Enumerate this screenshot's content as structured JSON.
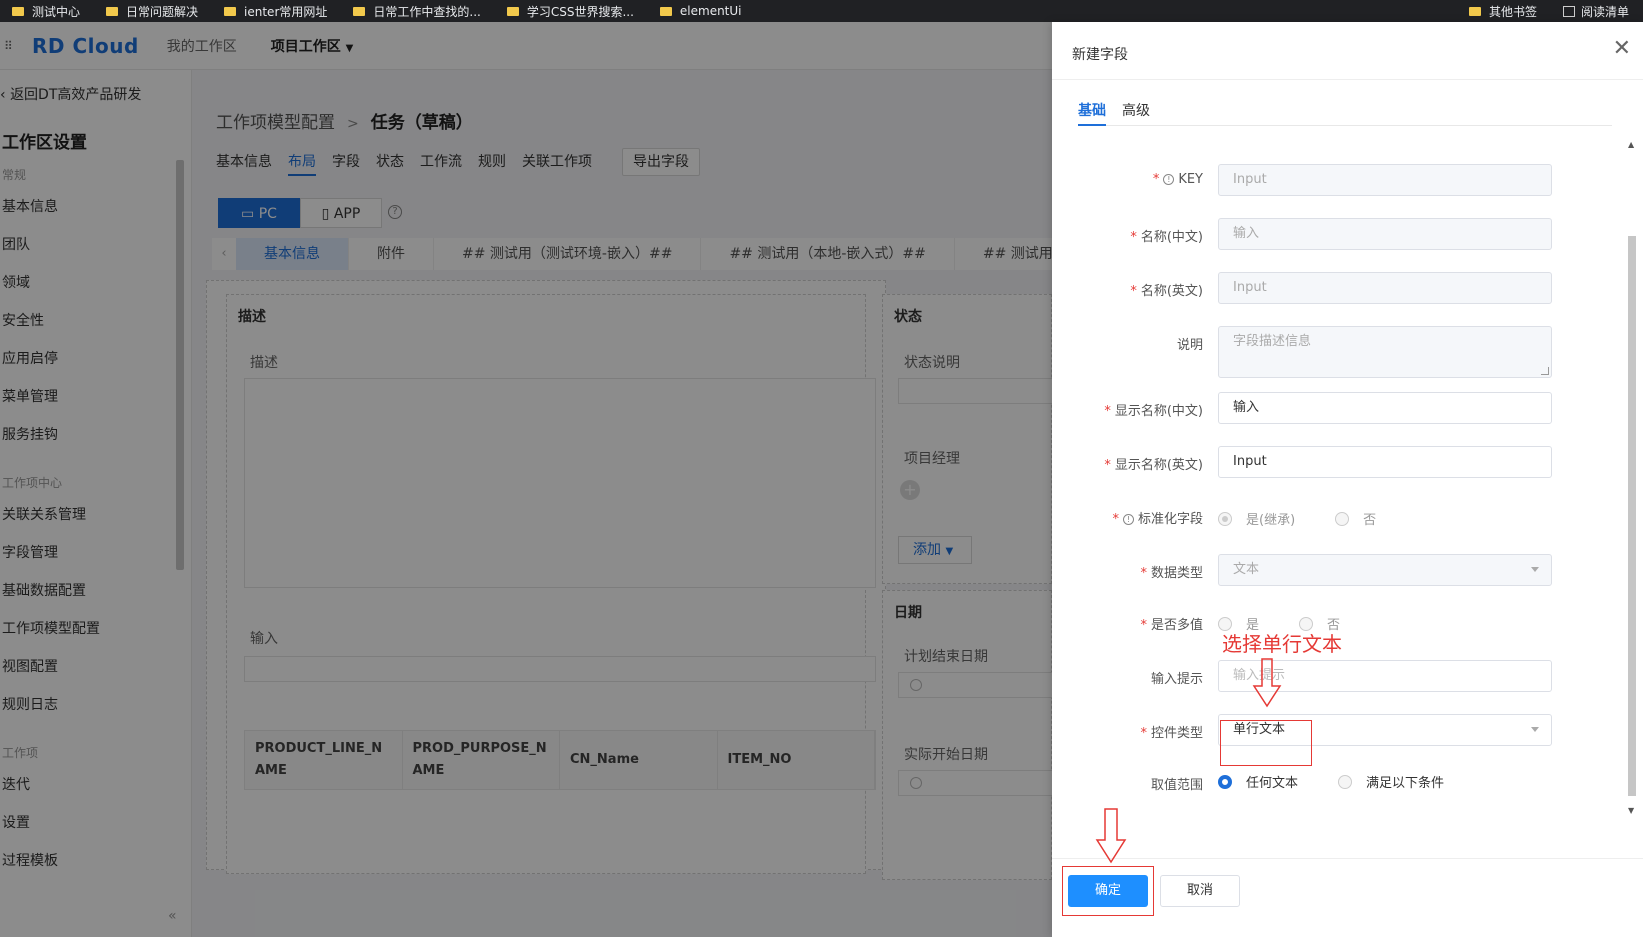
{
  "bookmarks": [
    {
      "label": "测试中心"
    },
    {
      "label": "日常问题解决"
    },
    {
      "label": "ienter常用网址"
    },
    {
      "label": "日常工作中查找的..."
    },
    {
      "label": "学习CSS世界搜索..."
    },
    {
      "label": "elementUi"
    }
  ],
  "bookmarks_right": {
    "other": "其他书签",
    "reading": "阅读清单"
  },
  "topbar": {
    "logo": "RD Cloud",
    "nav_my": "我的工作区",
    "nav_project": "项目工作区"
  },
  "sidebar": {
    "back": "返回DT高效产品研发",
    "title": "工作区设置",
    "group_general": "常规",
    "general_items": [
      "基本信息",
      "团队",
      "领域",
      "安全性",
      "应用启停",
      "菜单管理",
      "服务挂钩"
    ],
    "group_workitem": "工作项中心",
    "workitem_items": [
      "关联关系管理",
      "字段管理",
      "基础数据配置",
      "工作项模型配置",
      "视图配置",
      "规则日志"
    ],
    "group_work": "工作项",
    "work_items": [
      "迭代",
      "设置",
      "过程模板"
    ]
  },
  "main": {
    "crumb_parent": "工作项模型配置",
    "crumb_sep": ">",
    "crumb_current": "任务（草稿）",
    "tabs": [
      "基本信息",
      "布局",
      "字段",
      "状态",
      "工作流",
      "规则",
      "关联工作项"
    ],
    "export_btn": "导出字段",
    "seg_pc": "PC",
    "seg_app": "APP",
    "sections": [
      "基本信息",
      "附件",
      "## 测试用（测试环境-嵌入）##",
      "## 测试用（本地-嵌入式）##",
      "## 测试用(本"
    ],
    "left_panel": {
      "title": "描述",
      "label1": "描述",
      "label2": "输入"
    },
    "table_headers": [
      "PRODUCT_LINE_NAME",
      "PROD_PURPOSE_NAME",
      "CN_Name",
      "ITEM_NO"
    ],
    "right_panel": {
      "title": "状态",
      "label_status": "状态说明",
      "label_pm": "项目经理",
      "add_btn": "添加"
    },
    "date_panel": {
      "title": "日期",
      "label_end": "计划结束日期",
      "label_start": "实际开始日期"
    }
  },
  "drawer": {
    "title": "新建字段",
    "tabs": [
      "基础",
      "高级"
    ],
    "fields": {
      "key": {
        "label": "KEY",
        "placeholder": "Input"
      },
      "name_cn": {
        "label": "名称(中文)",
        "placeholder": "输入"
      },
      "name_en": {
        "label": "名称(英文)",
        "placeholder": "Input"
      },
      "desc": {
        "label": "说明",
        "placeholder": "字段描述信息"
      },
      "display_cn": {
        "label": "显示名称(中文)",
        "value": "输入"
      },
      "display_en": {
        "label": "显示名称(英文)",
        "value": "Input"
      },
      "standard": {
        "label": "标准化字段",
        "opt_yes": "是(继承)",
        "opt_no": "否"
      },
      "data_type": {
        "label": "数据类型",
        "value": "文本"
      },
      "multi": {
        "label": "是否多值",
        "opt_yes": "是",
        "opt_no": "否"
      },
      "hint": {
        "label": "输入提示",
        "placeholder": "输入提示"
      },
      "control": {
        "label": "控件类型",
        "value": "单行文本"
      },
      "range": {
        "label": "取值范围",
        "opt_any": "任何文本",
        "opt_cond": "满足以下条件"
      }
    },
    "ok": "确定",
    "cancel": "取消"
  },
  "annotation": {
    "text": "选择单行文本",
    "color": "#e53935"
  }
}
